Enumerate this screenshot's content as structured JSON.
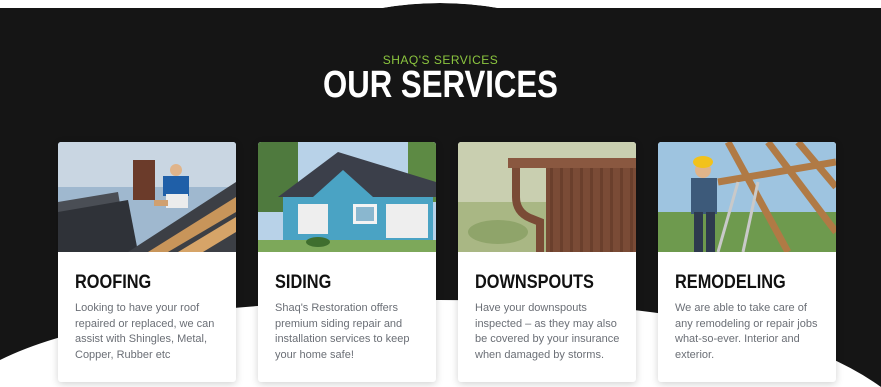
{
  "section": {
    "eyebrow": "SHAQ'S SERVICES",
    "title": "OUR SERVICES"
  },
  "colors": {
    "background_dark": "#151515",
    "accent_green": "#8cc63f",
    "card_text": "#6b6f76",
    "heading_text": "#111111"
  },
  "services": [
    {
      "title": "ROOFING",
      "description": "Looking to have your roof repaired or replaced, we can assist with Shingles, Metal, Copper, Rubber etc",
      "image": "roofer-working-on-roof-photo"
    },
    {
      "title": "SIDING",
      "description": "Shaq's Restoration offers premium siding repair and installation services to keep your home safe!",
      "image": "blue-sided-house-photo"
    },
    {
      "title": "DOWNSPOUTS",
      "description": "Have your downspouts inspected – as they may also be covered by your insurance when damaged by storms.",
      "image": "downspout-gutter-photo"
    },
    {
      "title": "REMODELING",
      "description": "We are able to take care of any remodeling or repair jobs what-so-ever. Interior and exterior.",
      "image": "carpenter-on-ladder-photo"
    }
  ]
}
